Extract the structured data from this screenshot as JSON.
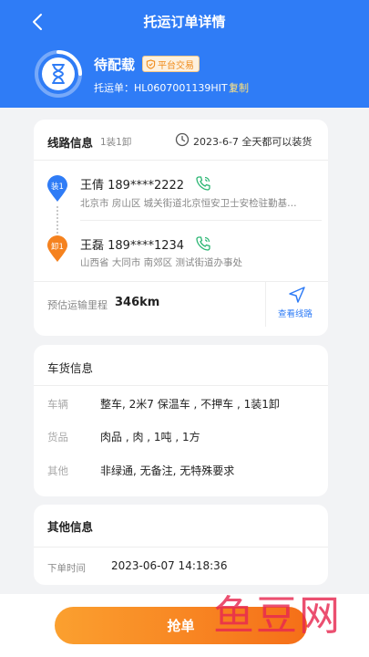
{
  "header": {
    "title": "托运订单详情",
    "status": "待配载",
    "platform_badge": "平台交易",
    "order_no": "托运单：HL0607001139HIT｜",
    "copy_label": "复制"
  },
  "route": {
    "section_title": "线路信息",
    "count": "1装1卸",
    "load_date": "2023-6-7 全天都可以装货",
    "stops": [
      {
        "tag": "装1",
        "color": "#2f7cf6",
        "contact": "王倩 189****2222",
        "address": "北京市 房山区 城关街道北京恒安卫士安检驻勤基…"
      },
      {
        "tag": "卸1",
        "color": "#f5821f",
        "contact": "王磊 189****1234",
        "address": "山西省 大同市 南郊区 测试街道办事处"
      }
    ],
    "distance_label": "预估运输里程",
    "distance_value": "346km",
    "view_route": "查看线路"
  },
  "cargo": {
    "section_title": "车货信息",
    "rows": [
      {
        "label": "车辆",
        "value": "整车, 2米7 保温车 , 不押车 , 1装1卸"
      },
      {
        "label": "货品",
        "value": "肉品 , 肉 , 1吨 , 1方"
      },
      {
        "label": "其他",
        "value": "非绿通, 无备注, 无特殊要求"
      }
    ]
  },
  "other": {
    "section_title": "其他信息",
    "order_time_label": "下单时间",
    "order_time_value": "2023-06-07 14:18:36"
  },
  "action": {
    "grab_label": "抢单"
  },
  "watermark": "鱼豆网",
  "colors": {
    "brand": "#2f7cf6",
    "accent": "#f5821f"
  }
}
